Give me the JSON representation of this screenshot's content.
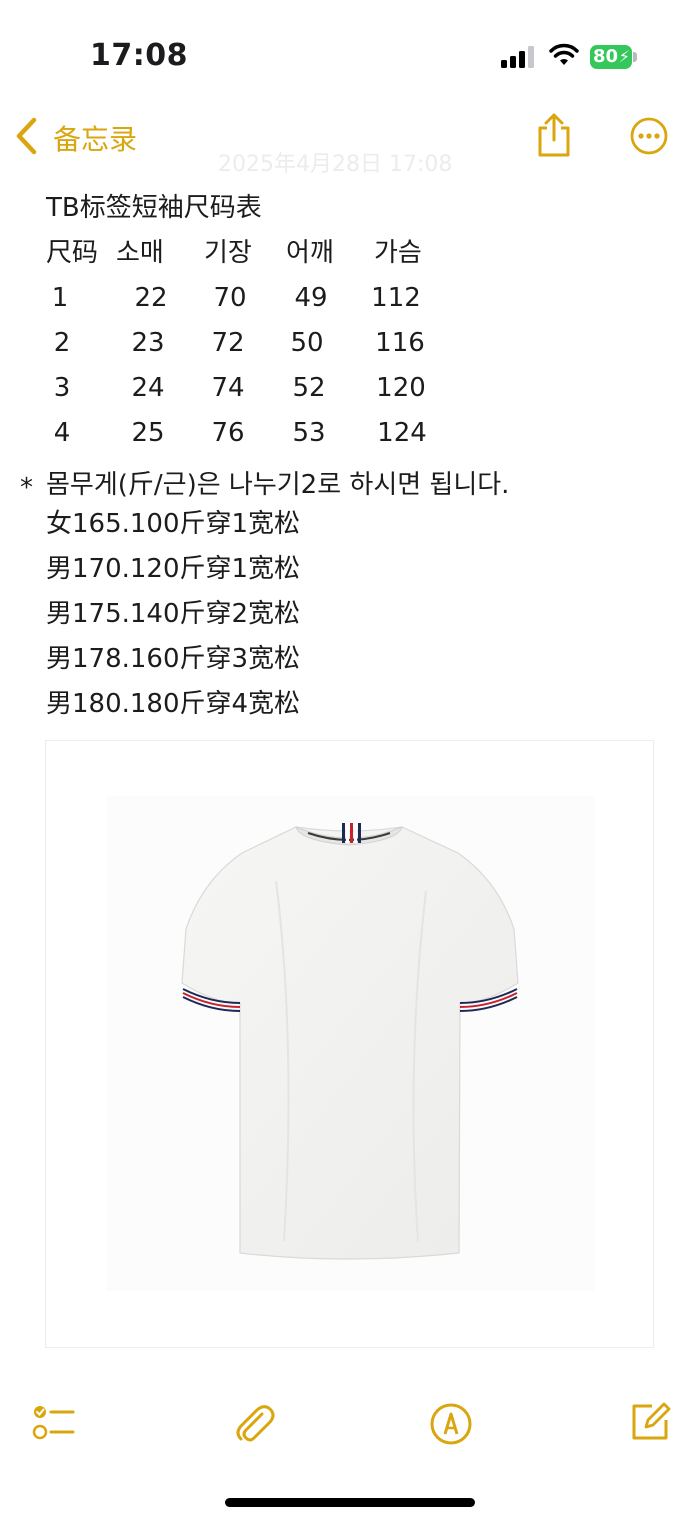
{
  "status_bar": {
    "time": "17:08",
    "battery": "80"
  },
  "nav": {
    "back_label": "备忘录",
    "faded_date": "2025年4月28日 17:08"
  },
  "note": {
    "title": "TB标签短袖尺码表",
    "table": {
      "headers": [
        "尺码",
        "소매",
        "기장",
        "어깨",
        "가슴"
      ],
      "rows": [
        [
          "1",
          "22",
          "70",
          "49",
          "112"
        ],
        [
          "2",
          "23",
          "72",
          "50",
          "116"
        ],
        [
          "3",
          "24",
          "74",
          "52",
          "120"
        ],
        [
          "4",
          "25",
          "76",
          "53",
          "124"
        ]
      ]
    },
    "bullet": "*",
    "weight_note": "몸무게(斤/근)은 나누기2로 하시면 됩니다.",
    "weight_guide": [
      "女165.100斤穿1宽松",
      "男170.120斤穿1宽松",
      "男175.140斤穿2宽松",
      "男178.160斤穿3宽松",
      "男180.180斤穿4宽松"
    ],
    "image": "white-tshirt-photo"
  },
  "toolbar": {
    "icons": [
      "checklist-icon",
      "paperclip-icon",
      "markup-pen-icon",
      "compose-icon"
    ]
  },
  "colors": {
    "accent": "#d9a60e",
    "text": "#1c1c1e",
    "battery": "#34c759"
  }
}
